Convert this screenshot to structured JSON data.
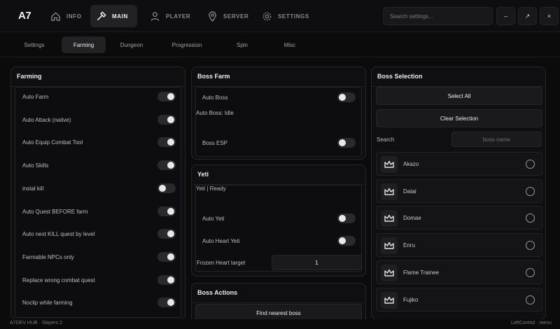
{
  "app": {
    "logo": "A7",
    "search_placeholder": "Search settings..."
  },
  "nav": [
    {
      "label": "INFO"
    },
    {
      "label": "MAIN"
    },
    {
      "label": "PLAYER"
    },
    {
      "label": "SERVER"
    },
    {
      "label": "SETTINGS"
    }
  ],
  "window_buttons": {
    "minimize": "–",
    "maximize": "↗",
    "close": "×"
  },
  "subtabs": [
    "Settings",
    "Farming",
    "Dungeon",
    "Progression",
    "Spin",
    "Misc"
  ],
  "farming": {
    "title": "Farming",
    "items": [
      {
        "label": "Auto Farm",
        "on": true
      },
      {
        "label": "Auto Attack (native)",
        "on": true
      },
      {
        "label": "Auto Equip Combat Tool",
        "on": true
      },
      {
        "label": "Auto Skills",
        "on": true
      },
      {
        "label": "instal kill",
        "on": false
      },
      {
        "label": "Auto Quest BEFORE farm",
        "on": true
      },
      {
        "label": "Auto next KILL quest by level",
        "on": true
      },
      {
        "label": "Farmable NPCs only",
        "on": true
      },
      {
        "label": "Replace wrong combat quest",
        "on": true
      },
      {
        "label": "Noclip while farming",
        "on": true
      }
    ]
  },
  "boss_farm": {
    "title": "Boss Farm",
    "auto_boss": "Auto Boss",
    "status": "Auto Boss: Idle",
    "boss_esp": "Boss ESP"
  },
  "yeti": {
    "title": "Yeti",
    "status": "Yeti | Ready",
    "auto_yeti": "Auto Yeti",
    "auto_heart": "Auto Heart Yeti",
    "frozen_label": "Frozen Heart target",
    "frozen_value": "1"
  },
  "boss_actions": {
    "title": "Boss Actions",
    "find_nearest": "Find nearest boss"
  },
  "boss_selection": {
    "title": "Boss Selection",
    "select_all": "Select All",
    "clear": "Clear Selection",
    "search_label": "Search",
    "search_placeholder": "boss name",
    "bosses": [
      "Akazo",
      "Datai",
      "Domae",
      "Enru",
      "Flame Trainee",
      "Fujiko"
    ]
  },
  "footer": {
    "left": "A7DEV HUB · Slayers 2",
    "right": "LeftControl · menu"
  }
}
